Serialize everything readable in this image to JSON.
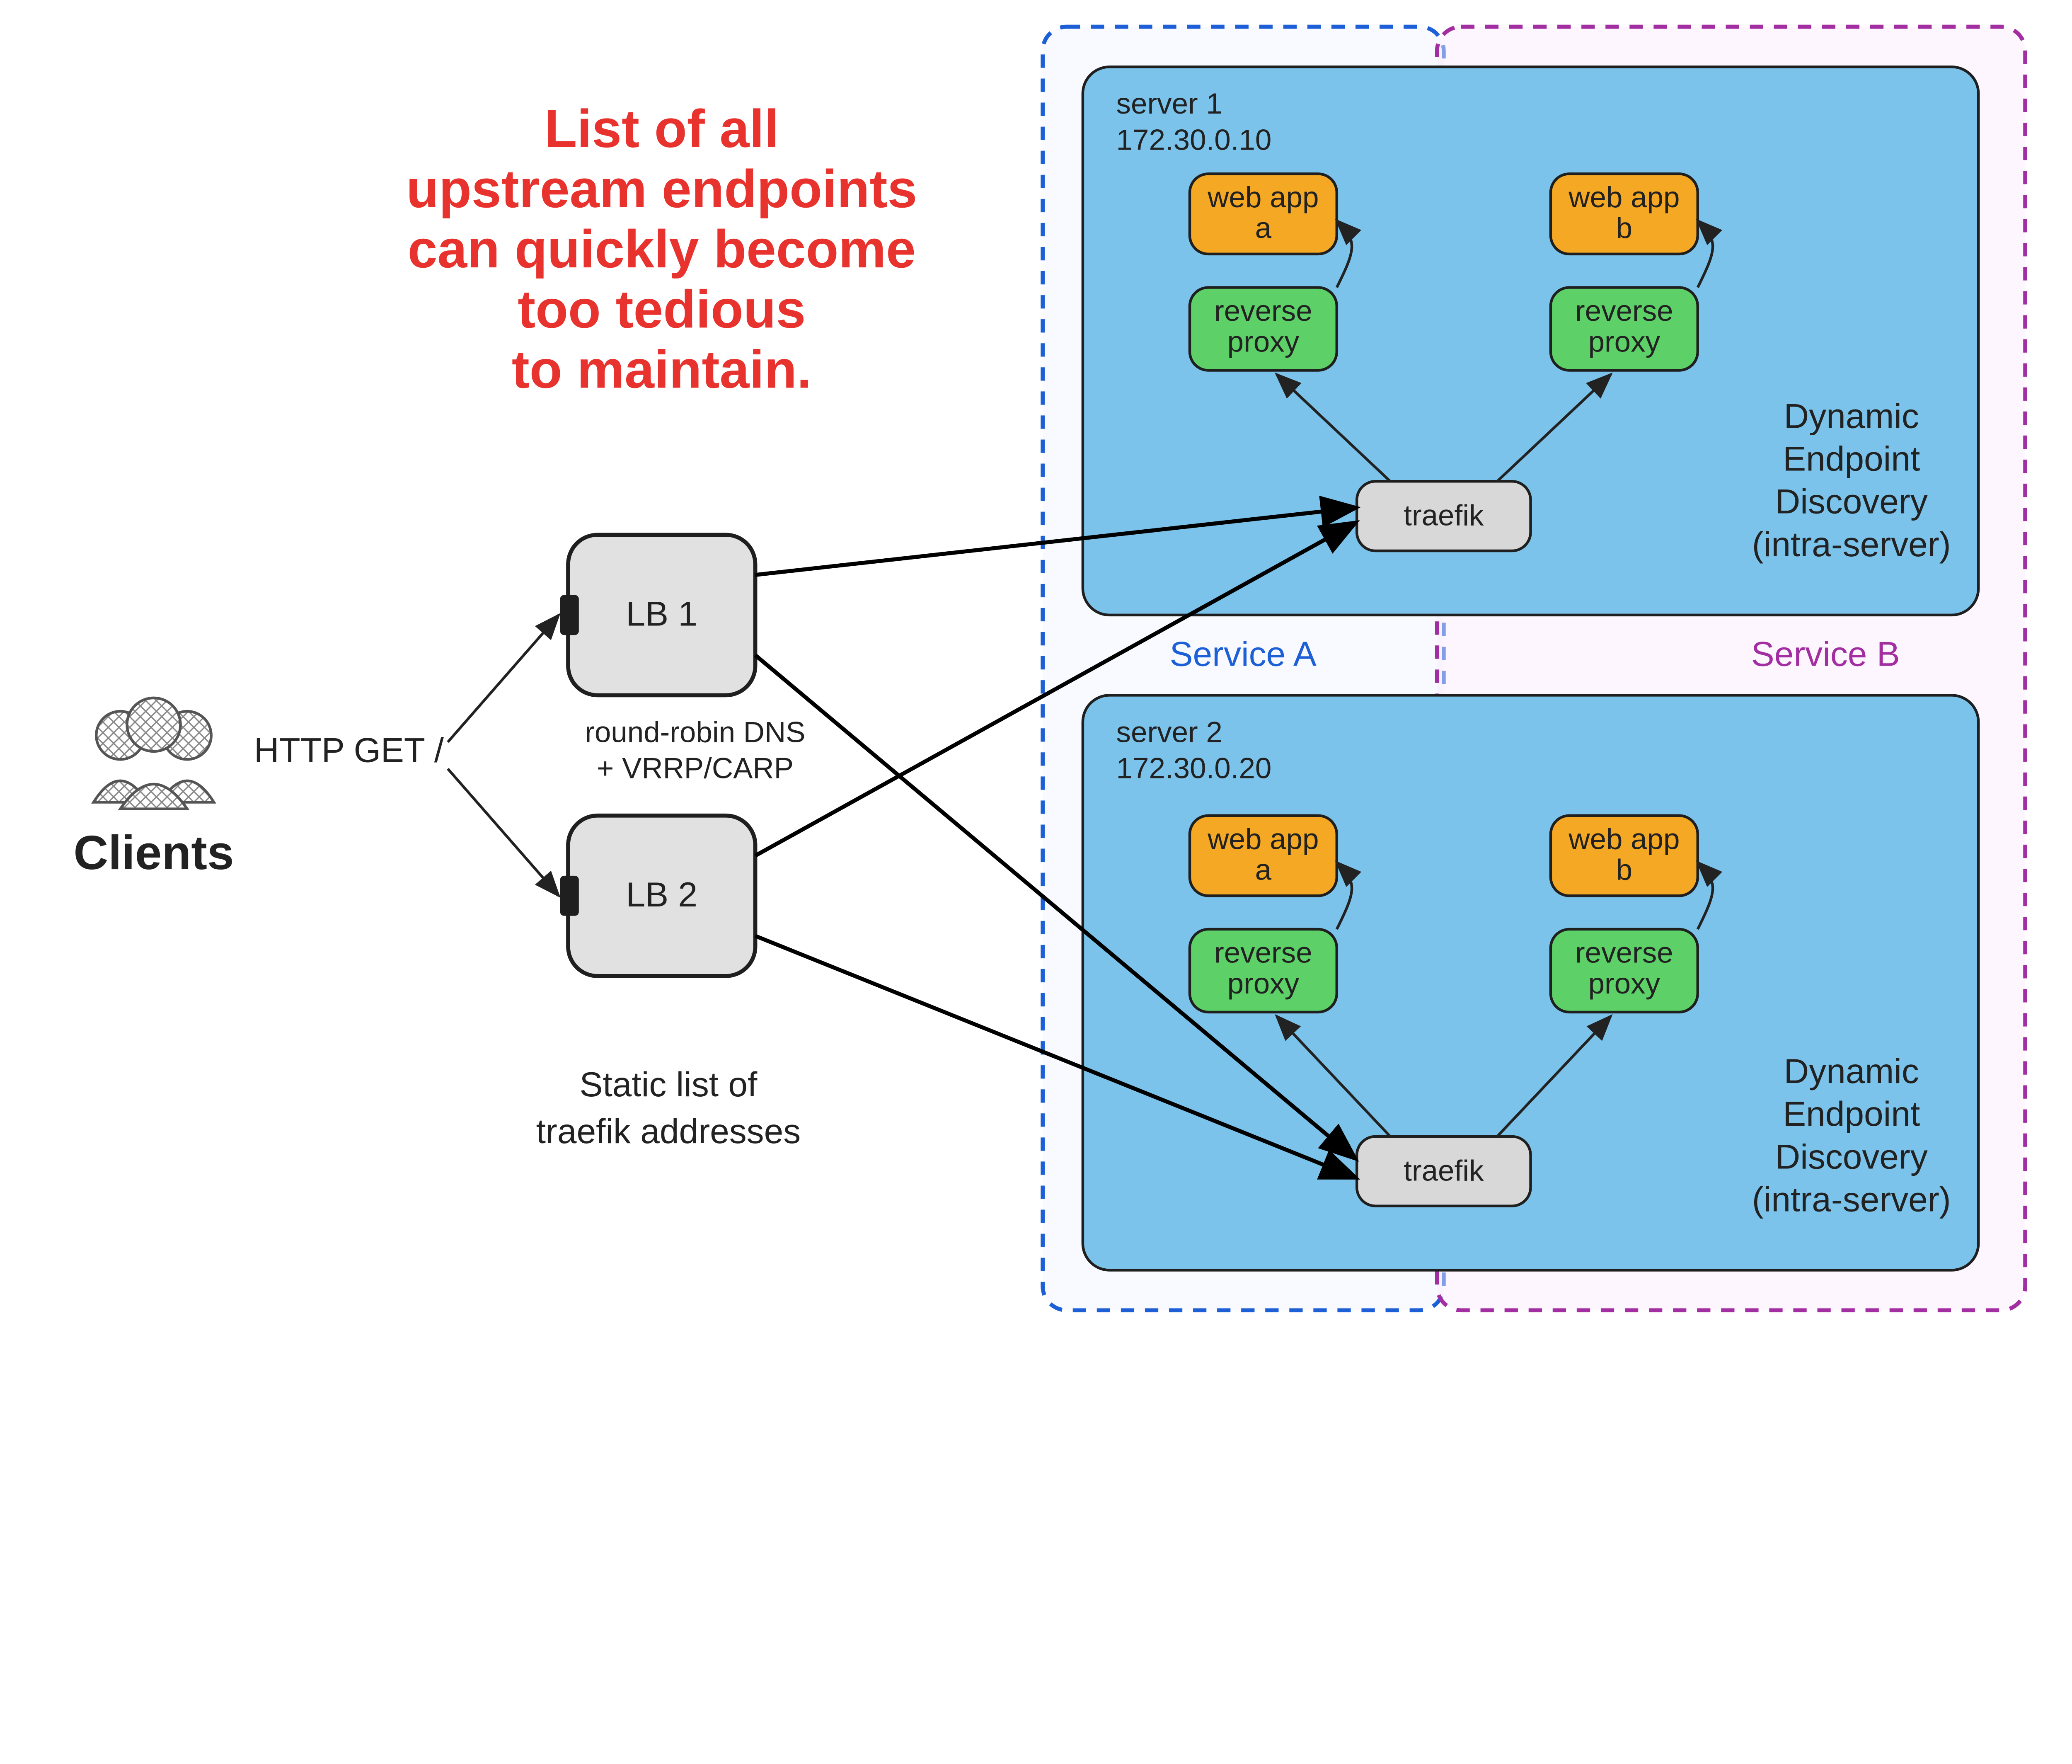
{
  "annotation": {
    "line1": "List of all",
    "line2": "upstream endpoints",
    "line3": "can quickly become",
    "line4": "too tedious",
    "line5": "to maintain."
  },
  "clients": {
    "label": "Clients",
    "request": "HTTP GET /"
  },
  "lb": {
    "lb1": "LB 1",
    "lb2": "LB 2",
    "note": "round-robin DNS\n+ VRRP/CARP",
    "caption1": "Static list of",
    "caption2": "traefik addresses"
  },
  "services": {
    "a": "Service A",
    "b": "Service B"
  },
  "server1": {
    "title": "server 1",
    "ip": "172.30.0.10",
    "traefik": "traefik",
    "webapp_a": "web app\na",
    "webapp_b": "web app\nb",
    "proxy_a": "reverse\nproxy",
    "proxy_b": "reverse\nproxy",
    "discovery1": "Dynamic",
    "discovery2": "Endpoint",
    "discovery3": "Discovery",
    "discovery4": "(intra-server)"
  },
  "server2": {
    "title": "server 2",
    "ip": "172.30.0.20",
    "traefik": "traefik",
    "webapp_a": "web app\na",
    "webapp_b": "web app\nb",
    "proxy_a": "reverse\nproxy",
    "proxy_b": "reverse\nproxy",
    "discovery1": "Dynamic",
    "discovery2": "Endpoint",
    "discovery3": "Discovery",
    "discovery4": "(intra-server)"
  }
}
